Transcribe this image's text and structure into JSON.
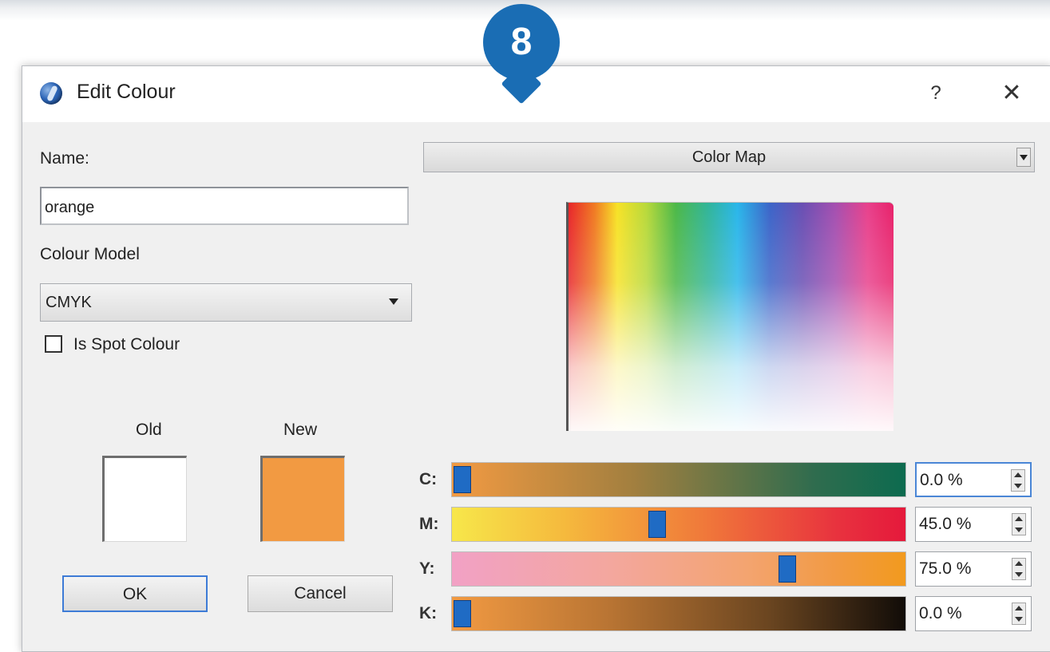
{
  "callout": {
    "number": "8"
  },
  "window": {
    "title": "Edit Colour",
    "help_label": "?",
    "close_label": "✕"
  },
  "left_panel": {
    "name_label": "Name:",
    "name_value": "orange",
    "model_label": "Colour Model",
    "model_value": "CMYK",
    "spot_label": "Is Spot Colour",
    "spot_checked": false,
    "old_label": "Old",
    "new_label": "New",
    "old_color": "#ffffff",
    "new_color": "#f29a42",
    "ok_label": "OK",
    "cancel_label": "Cancel"
  },
  "right_panel": {
    "map_mode": "Color Map",
    "channels": [
      {
        "label": "C:",
        "value": "0.0 %",
        "fraction": 0.0
      },
      {
        "label": "M:",
        "value": "45.0 %",
        "fraction": 0.45
      },
      {
        "label": "Y:",
        "value": "75.0 %",
        "fraction": 0.75
      },
      {
        "label": "K:",
        "value": "0.0 %",
        "fraction": 0.0
      }
    ]
  }
}
